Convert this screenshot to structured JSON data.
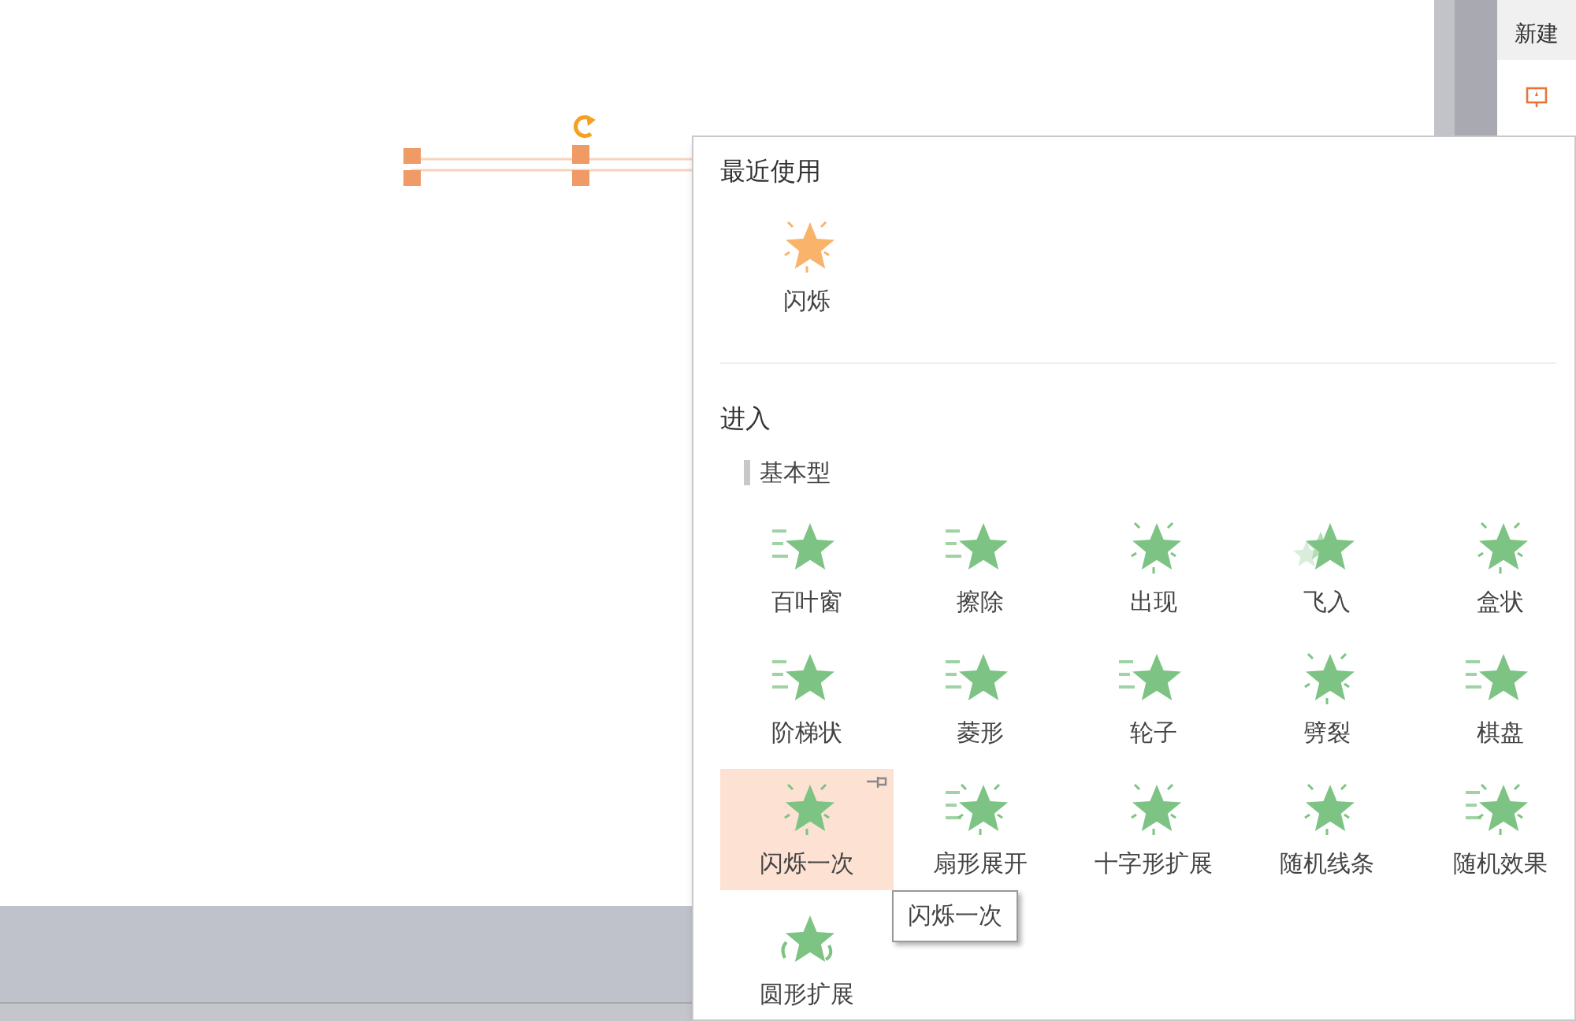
{
  "sidebar": {
    "items": [
      {
        "label": "新建"
      }
    ]
  },
  "panel": {
    "recent": {
      "heading": "最近使用",
      "items": [
        {
          "label": "闪烁"
        }
      ]
    },
    "entrance": {
      "heading": "进入",
      "group": "基本型",
      "items": [
        {
          "label": "百叶窗",
          "selected": false
        },
        {
          "label": "擦除",
          "selected": false
        },
        {
          "label": "出现",
          "selected": false
        },
        {
          "label": "飞入",
          "selected": false
        },
        {
          "label": "盒状",
          "selected": false
        },
        {
          "label": "阶梯状",
          "selected": false
        },
        {
          "label": "菱形",
          "selected": false
        },
        {
          "label": "轮子",
          "selected": false
        },
        {
          "label": "劈裂",
          "selected": false
        },
        {
          "label": "棋盘",
          "selected": false
        },
        {
          "label": "闪烁一次",
          "selected": true
        },
        {
          "label": "扇形展开",
          "selected": false
        },
        {
          "label": "十字形扩展",
          "selected": false
        },
        {
          "label": "随机线条",
          "selected": false
        },
        {
          "label": "随机效果",
          "selected": false
        },
        {
          "label": "圆形扩展",
          "selected": false
        }
      ]
    },
    "tooltip": "闪烁一次"
  }
}
